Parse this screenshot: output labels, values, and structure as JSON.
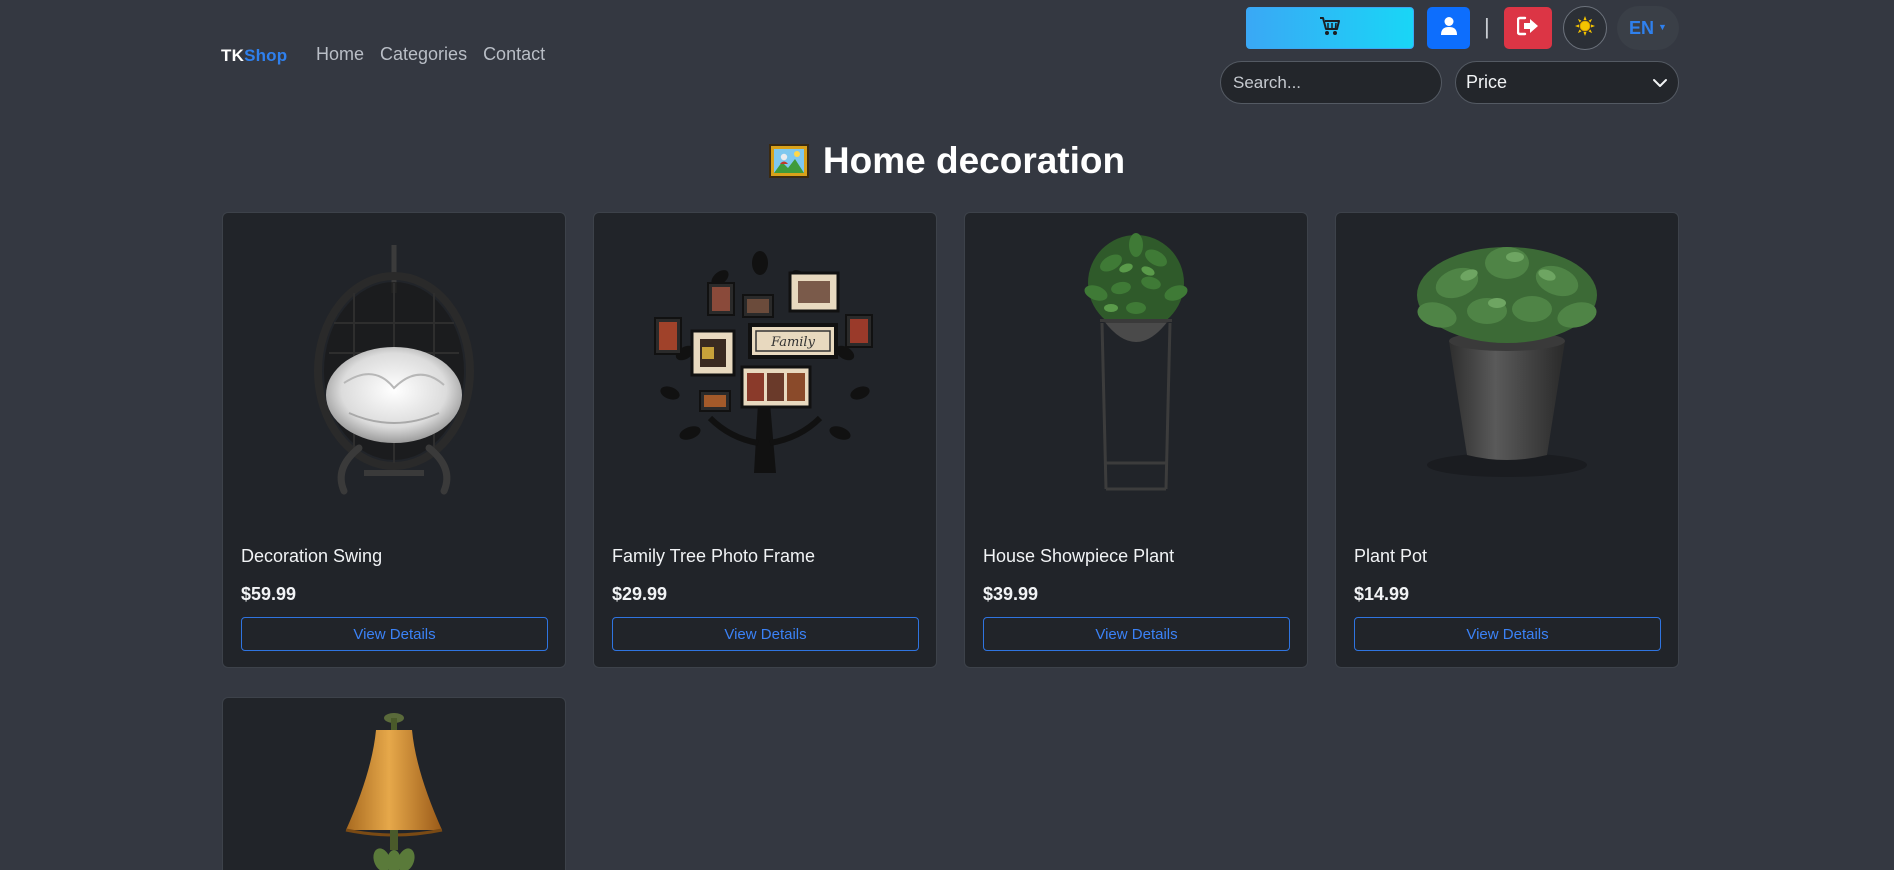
{
  "brand": {
    "tk": "TK",
    "shop": "Shop"
  },
  "nav": {
    "links": [
      "Home",
      "Categories",
      "Contact"
    ]
  },
  "header": {
    "separator": "|",
    "lang": "EN",
    "search_placeholder": "Search...",
    "sort_value": "Price"
  },
  "colors": {
    "primary": "#0d6efd",
    "danger": "#dc3545",
    "cart_gradient_start": "#3aa8f5",
    "cart_gradient_end": "#19d6f6",
    "background": "#343841"
  },
  "page": {
    "title": "Home decoration"
  },
  "products": [
    {
      "name": "Decoration Swing",
      "price": "$59.99",
      "button": "View Details"
    },
    {
      "name": "Family Tree Photo Frame",
      "price": "$29.99",
      "button": "View Details"
    },
    {
      "name": "House Showpiece Plant",
      "price": "$39.99",
      "button": "View Details"
    },
    {
      "name": "Plant Pot",
      "price": "$14.99",
      "button": "View Details"
    }
  ],
  "icons": {
    "cart": "shopping-cart-icon",
    "user": "user-icon",
    "logout": "logout-icon",
    "theme": "sun-icon",
    "sort": "chevron-down-icon",
    "title": "framed-picture-icon"
  }
}
